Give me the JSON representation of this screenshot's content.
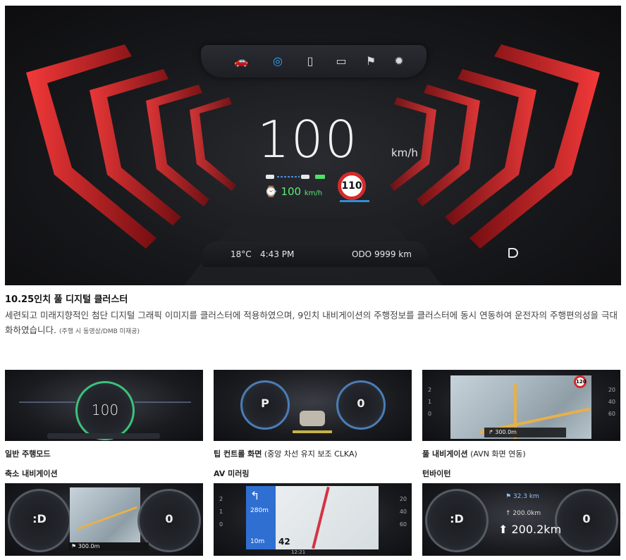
{
  "hero": {
    "speed": "100",
    "speed_unit": "km/h",
    "acc_speed": "100",
    "acc_unit": "km/h",
    "speed_limit": "110",
    "temperature": "18°C",
    "time": "4:43 PM",
    "gear": "D",
    "odometer": "ODO 9999 km",
    "icons": [
      "car-icon",
      "gauge-icon",
      "battery-icon",
      "radio-icon",
      "flag-icon",
      "gear-icon"
    ],
    "accent_color": "#d4202a"
  },
  "caption": {
    "title": "10.25인치 풀 디지털 클러스터",
    "body": "세련되고 미래지향적인 첨단 디지털 그래픽 이미지를 클러스터에 적용하였으며, 9인치 내비게이션의 주행정보를 클러스터에 동시 연동하여 운전자의 주행편의성을 극대화하였습니다.",
    "note": "(주행 시 동영상/DMB 미재공)"
  },
  "thumbs": [
    {
      "title": "일반 주행모드",
      "sub": "",
      "display": "100"
    },
    {
      "title": "팁 컨트롤 화면",
      "sub": "(중앙 차선 유지 보조 CLKA)",
      "display_left": "P",
      "display_right": "0"
    },
    {
      "title": "풀 내비게이션",
      "sub": "(AVN 화면 연동)",
      "display": "300.0m",
      "limit": "120"
    },
    {
      "title": "축소 내비게이션",
      "sub": "",
      "display_left": ":D",
      "display_right": "0",
      "dist": "300.0m"
    },
    {
      "title": "AV 미러링",
      "sub": "",
      "dist_a": "280m",
      "dist_b": "10m",
      "num": "42",
      "time": "12:21"
    },
    {
      "title": "턴바이턴",
      "sub": "",
      "display_left": ":D",
      "display_right": "0",
      "dist_a": "32.3 km",
      "dist_b": "200.0",
      "dist_b_unit": "km",
      "dist_c": "200.2km"
    }
  ]
}
